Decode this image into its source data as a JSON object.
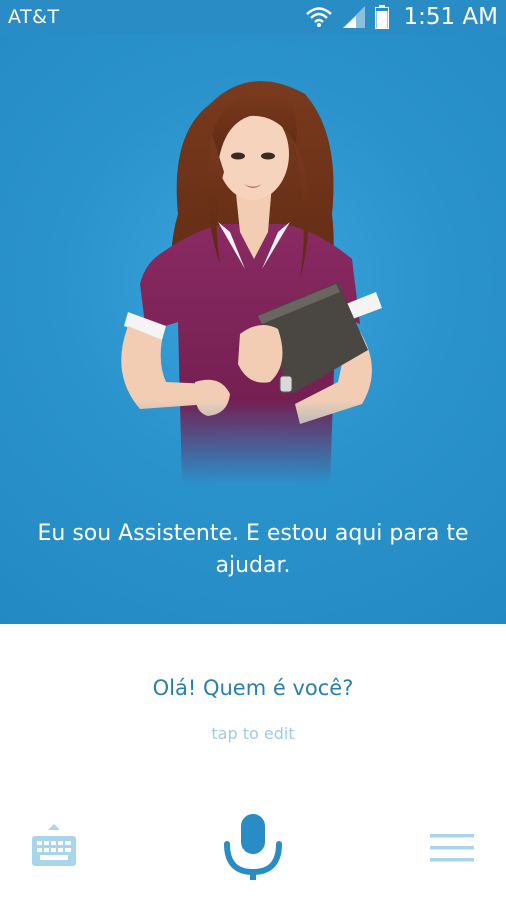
{
  "status_bar": {
    "carrier": "AT&T",
    "time": "1:51 AM",
    "icons": [
      "wifi-icon",
      "signal-icon",
      "battery-icon"
    ]
  },
  "assistant": {
    "avatar": "assistant-avatar-illustration",
    "message": "Eu sou Assistente. E estou aqui para te ajudar."
  },
  "query": {
    "text": "Olá! Quem é você?",
    "hint": "tap to edit"
  },
  "bottom_bar": {
    "icons": [
      "keyboard-icon",
      "microphone-icon",
      "menu-icon"
    ]
  },
  "colors": {
    "accent": "#2a8cc4",
    "query_text": "#2a7fb0",
    "hint_text": "#9ccde6",
    "icon_light": "#a8d4ec"
  }
}
